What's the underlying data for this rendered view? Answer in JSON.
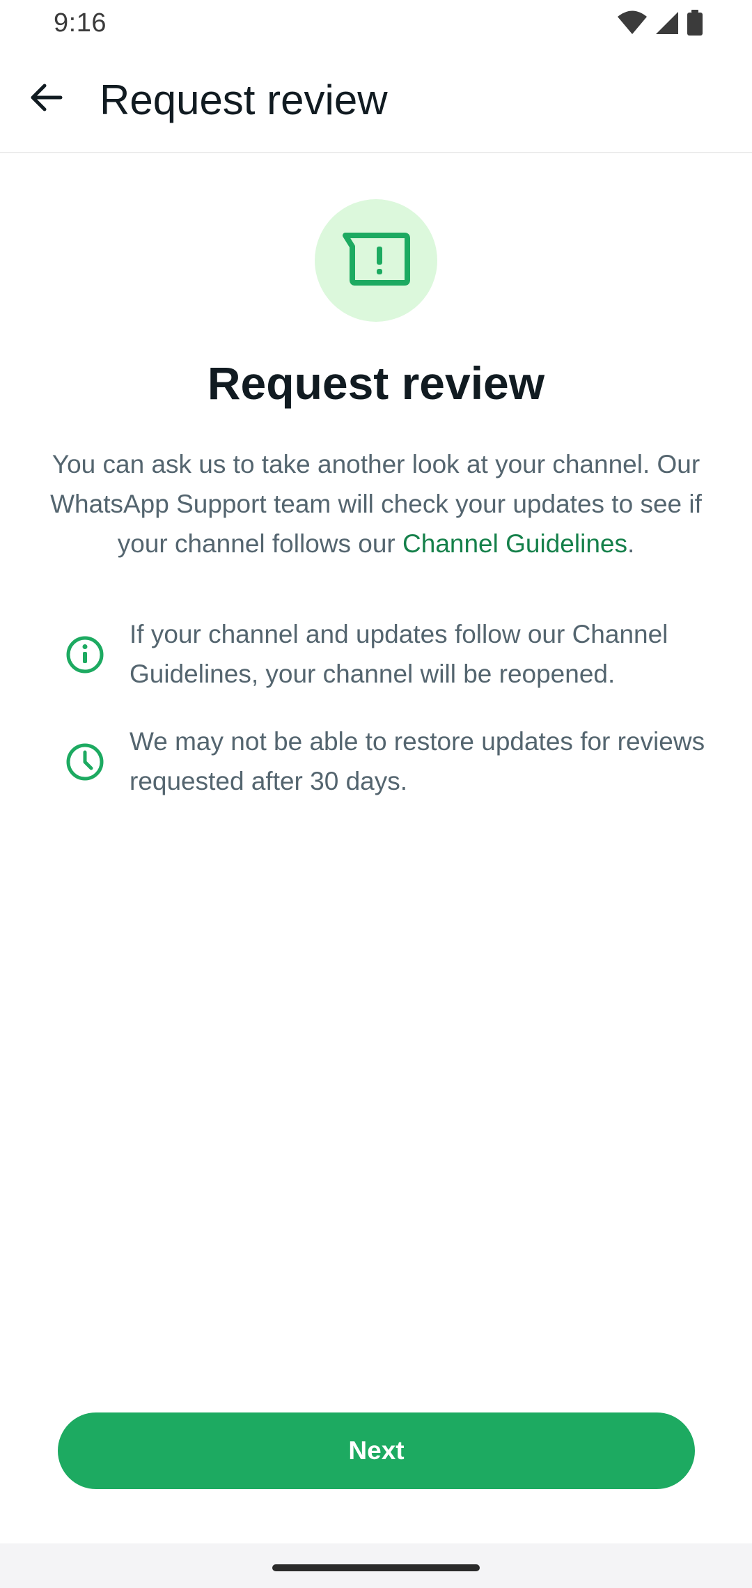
{
  "status_bar": {
    "time": "9:16",
    "icons": [
      "wifi-icon",
      "cellular-signal-icon",
      "battery-icon"
    ]
  },
  "app_bar": {
    "back_icon": "arrow-back-icon",
    "title": "Request review"
  },
  "hero": {
    "icon": "report-message-icon",
    "title": "Request review"
  },
  "description": {
    "text": "You can ask us to take another look at your channel. Our WhatsApp Support team will check your updates to see if your channel follows our ",
    "link_text": "Channel Guidelines",
    "suffix": "."
  },
  "info_items": [
    {
      "icon": "info-icon",
      "text": "If your channel and updates follow our Channel Guidelines, your channel will be reopened."
    },
    {
      "icon": "clock-icon",
      "text": "We may not be able to restore updates for reviews requested after 30 days."
    }
  ],
  "actions": {
    "next_label": "Next"
  },
  "colors": {
    "accent": "#1daa61",
    "link": "#15804a",
    "hero_bg": "#dcf8dc",
    "text_primary": "#111b21",
    "text_secondary": "#54656f"
  }
}
